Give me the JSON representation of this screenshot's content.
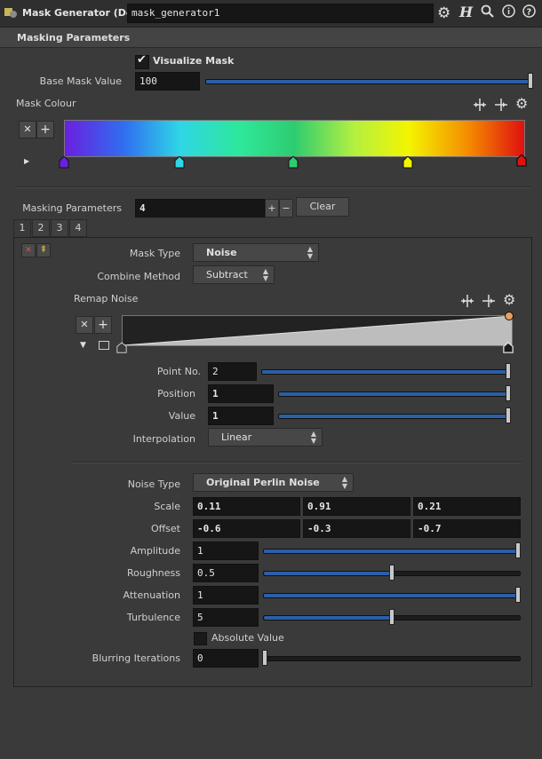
{
  "header": {
    "node_type": "Mask Generator (Dev)",
    "node_name": "mask_generator1"
  },
  "section": {
    "title": "Masking Parameters"
  },
  "visualize_mask": {
    "label": "Visualize Mask",
    "checked": true
  },
  "base_mask": {
    "label": "Base Mask Value",
    "value": "100",
    "fraction": 1.0
  },
  "mask_colour": {
    "label": "Mask Colour",
    "key_colors": [
      "#6b1fe0",
      "#2fd6e6",
      "#2ecc71",
      "#f4f400",
      "#e01010"
    ]
  },
  "masking_params": {
    "label": "Masking Parameters",
    "value": "4",
    "plus": "+",
    "minus": "−",
    "clear": "Clear"
  },
  "tabs": [
    "1",
    "2",
    "3",
    "4"
  ],
  "mask_type": {
    "label": "Mask Type",
    "value": "Noise"
  },
  "combine_method": {
    "label": "Combine Method",
    "value": "Subtract"
  },
  "remap_noise": {
    "label": "Remap Noise"
  },
  "point_no": {
    "label": "Point No.",
    "value": "2",
    "fraction": 1.0
  },
  "position": {
    "label": "Position",
    "value": "1",
    "fraction": 1.0
  },
  "value": {
    "label": "Value",
    "value": "1",
    "fraction": 1.0
  },
  "interpolation": {
    "label": "Interpolation",
    "value": "Linear"
  },
  "noise_type": {
    "label": "Noise Type",
    "value": "Original Perlin Noise"
  },
  "scale": {
    "label": "Scale",
    "x": "0.11",
    "y": "0.91",
    "z": "0.21"
  },
  "offset": {
    "label": "Offset",
    "x": "-0.6",
    "y": "-0.3",
    "z": "-0.7"
  },
  "amplitude": {
    "label": "Amplitude",
    "value": "1",
    "fraction": 1.0
  },
  "roughness": {
    "label": "Roughness",
    "value": "0.5",
    "fraction": 0.5
  },
  "attenuation": {
    "label": "Attenuation",
    "value": "1",
    "fraction": 1.0
  },
  "turbulence": {
    "label": "Turbulence",
    "value": "5",
    "fraction": 0.5
  },
  "absolute_value": {
    "label": "Absolute Value",
    "checked": false
  },
  "blurring": {
    "label": "Blurring Iterations",
    "value": "0",
    "fraction": 0.0
  }
}
